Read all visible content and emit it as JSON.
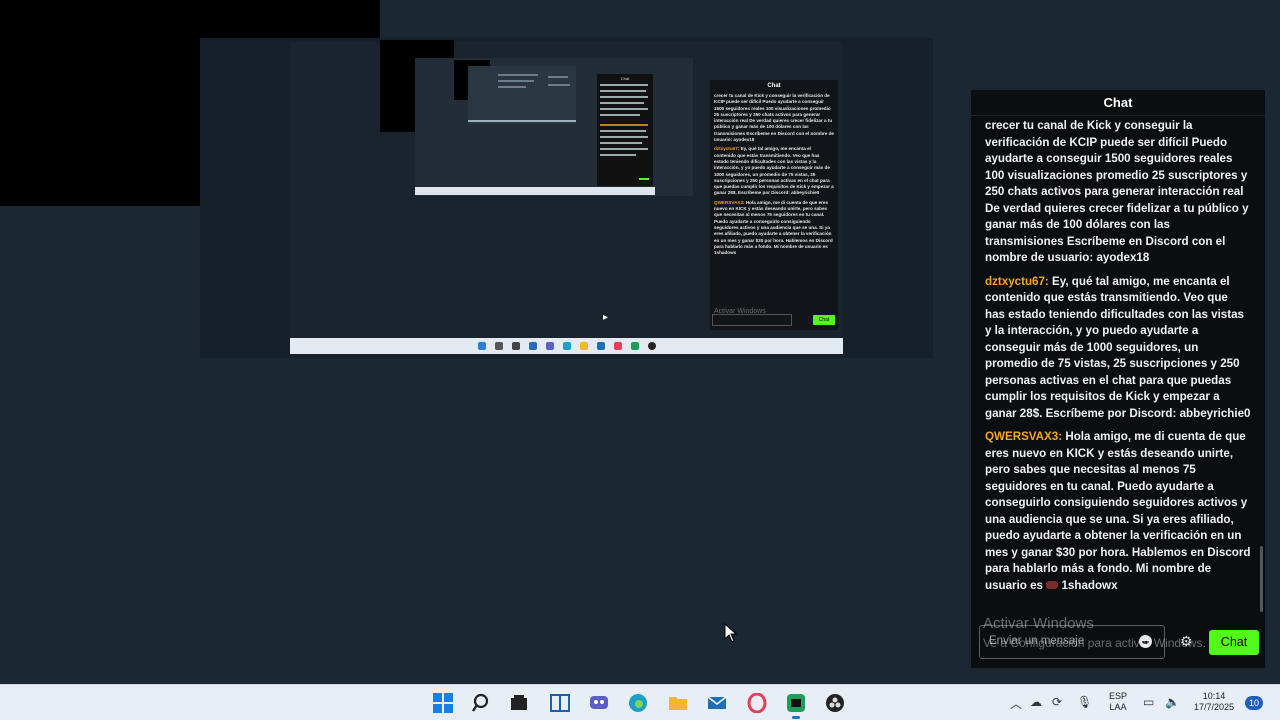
{
  "chat": {
    "title": "Chat",
    "messages": [
      {
        "user": "",
        "text": "crecer tu canal de Kick y conseguir la verificación de KCIP puede ser difícil Puedo ayudarte a conseguir 1500 seguidores reales 100 visualizaciones promedio 25 suscriptores y 250 chats activos para generar interacción real De verdad quieres crecer fidelizar a tu público y ganar más de 100 dólares con las transmisiones Escríbeme en Discord con el nombre de usuario: ayodex18"
      },
      {
        "user": "dztxyctu67",
        "text": "Ey, qué tal amigo, me encanta el contenido que estás transmitiendo. Veo que has estado teniendo dificultades con las vistas y la interacción, y yo puedo ayudarte a conseguir más de 1000 seguidores, un promedio de 75 vistas, 25 suscripciones y 250 personas activas en el chat para que puedas cumplir los requisitos de Kick y empezar a ganar 28$. Escríbeme por Discord: abbeyrichie0"
      },
      {
        "user": "QWERSVAX3",
        "text": "Hola amigo, me di cuenta de que eres nuevo en KICK y estás deseando unirte, pero sabes que necesitas al menos 75 seguidores en tu canal. Puedo ayudarte a conseguirlo consiguiendo seguidores activos y una audiencia que se una. Si ya eres afiliado, puedo ayudarte a obtener la verificación en un mes y ganar $30 por hora. Hablemos en Discord para hablarlo más a fondo. Mi nombre de usuario es",
        "handle": "1shadowx"
      }
    ],
    "input_placeholder": "Enviar un mensaje",
    "send_label": "Chat",
    "send_color": "#53fc18",
    "username_color": "#f5a623"
  },
  "watermark": {
    "title": "Activar Windows",
    "subtitle": "Ve a Configuración para activar Windows."
  },
  "nested": {
    "chat_title": "Chat",
    "chat_lines": [
      {
        "user": "",
        "text": "crecer tu canal de Kick y conseguir la verificación de KCIP puede ser difícil Puedo ayudarte a conseguir 1500 seguidores reales 100 visualizaciones promedio 25 suscriptores y 250 chats activos para generar interacción real De verdad quieres crecer fidelizar a tu público y ganar más de 100 dólares con las transmisiones Escríbeme en Discord con el nombre de usuario: ayodex18"
      },
      {
        "user": "dztxyctu67",
        "text": "Ey, qué tal amigo, me encanta el contenido que estás transmitiendo. Veo que has estado teniendo dificultades con las vistas y la interacción, y yo puedo ayudarte a conseguir más de 1000 seguidores, un promedio de 75 vistas, 25 suscripciones y 250 personas activas en el chat para que puedas cumplir los requisitos de Kick y empezar a ganar 28$. Escríbeme por Discord: abbeyrichie0"
      },
      {
        "user": "QWERSVAX3",
        "text": "Hola amigo, me di cuenta de que eres nuevo en KICK y estás deseando unirte, pero sabes que necesitas al menos 75 seguidores en tu canal. Puedo ayudarte a conseguirlo consiguiendo seguidores activos y una audiencia que se una. Si ya eres afiliado, puedo ayudarte a obtener la verificación en un mes y ganar $30 por hora. Hablemos en Discord para hablarlo más a fondo. Mi nombre de usuario es 1shadowx"
      }
    ],
    "watermark": "Activar Windows",
    "send_label": "Chat"
  },
  "taskbar": {
    "apps": [
      "windows-start",
      "search",
      "file-explorer-dark",
      "widgets",
      "teams",
      "edge",
      "folder",
      "mail",
      "opera",
      "kick-app",
      "obs"
    ],
    "lang_top": "ESP",
    "lang_bottom": "LAA",
    "time": "10:14",
    "date": "17/7/2025",
    "notifications": "10"
  }
}
